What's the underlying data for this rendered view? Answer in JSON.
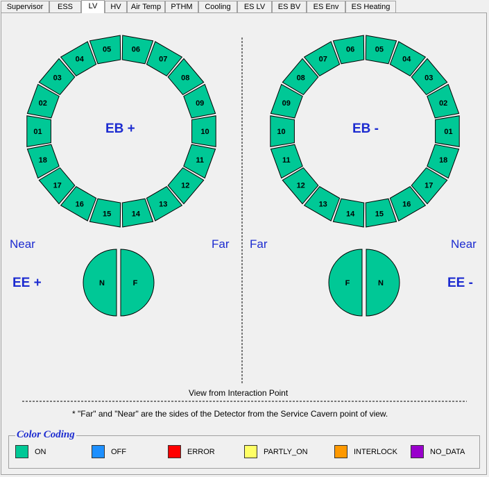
{
  "tabs": [
    {
      "label": "Supervisor",
      "active": false
    },
    {
      "label": "ESS",
      "active": false
    },
    {
      "label": "LV",
      "active": true
    },
    {
      "label": "HV",
      "active": false
    },
    {
      "label": "Air Temp",
      "active": false
    },
    {
      "label": "PTHM",
      "active": false
    },
    {
      "label": "Cooling",
      "active": false
    },
    {
      "label": "ES LV",
      "active": false
    },
    {
      "label": "ES BV",
      "active": false
    },
    {
      "label": "ES Env",
      "active": false
    },
    {
      "label": "ES Heating",
      "active": false
    }
  ],
  "colors": {
    "on": "#00c896",
    "off": "#1e90ff",
    "error": "#ff0000",
    "partly_on": "#ffff66",
    "interlock": "#ff9900",
    "no_data": "#9900cc",
    "accent_text": "#1c2bd0"
  },
  "eb_plus": {
    "label": "EB +",
    "sectors": [
      {
        "id": "01",
        "status": "on"
      },
      {
        "id": "02",
        "status": "on"
      },
      {
        "id": "03",
        "status": "on"
      },
      {
        "id": "04",
        "status": "on"
      },
      {
        "id": "05",
        "status": "on"
      },
      {
        "id": "06",
        "status": "on"
      },
      {
        "id": "07",
        "status": "on"
      },
      {
        "id": "08",
        "status": "on"
      },
      {
        "id": "09",
        "status": "on"
      },
      {
        "id": "10",
        "status": "on"
      },
      {
        "id": "11",
        "status": "on"
      },
      {
        "id": "12",
        "status": "on"
      },
      {
        "id": "13",
        "status": "on"
      },
      {
        "id": "14",
        "status": "on"
      },
      {
        "id": "15",
        "status": "on"
      },
      {
        "id": "16",
        "status": "on"
      },
      {
        "id": "17",
        "status": "on"
      },
      {
        "id": "18",
        "status": "on"
      }
    ]
  },
  "eb_minus": {
    "label": "EB -",
    "sectors": [
      {
        "id": "01",
        "status": "on"
      },
      {
        "id": "02",
        "status": "on"
      },
      {
        "id": "03",
        "status": "on"
      },
      {
        "id": "04",
        "status": "on"
      },
      {
        "id": "05",
        "status": "on"
      },
      {
        "id": "06",
        "status": "on"
      },
      {
        "id": "07",
        "status": "on"
      },
      {
        "id": "08",
        "status": "on"
      },
      {
        "id": "09",
        "status": "on"
      },
      {
        "id": "10",
        "status": "on"
      },
      {
        "id": "11",
        "status": "on"
      },
      {
        "id": "12",
        "status": "on"
      },
      {
        "id": "13",
        "status": "on"
      },
      {
        "id": "14",
        "status": "on"
      },
      {
        "id": "15",
        "status": "on"
      },
      {
        "id": "16",
        "status": "on"
      },
      {
        "id": "17",
        "status": "on"
      },
      {
        "id": "18",
        "status": "on"
      }
    ]
  },
  "ee_plus": {
    "label": "EE +",
    "left_side_label": "Near",
    "right_side_label": "Far",
    "halves": [
      {
        "id": "N",
        "status": "on"
      },
      {
        "id": "F",
        "status": "on"
      }
    ]
  },
  "ee_minus": {
    "label": "EE -",
    "left_side_label": "Far",
    "right_side_label": "Near",
    "halves": [
      {
        "id": "F",
        "status": "on"
      },
      {
        "id": "N",
        "status": "on"
      }
    ]
  },
  "view_caption": "View from Interaction Point",
  "footnote": "*  \"Far\" and \"Near\" are the sides of the Detector from the Service Cavern point of view.",
  "legend": {
    "title": "Color Coding",
    "items": [
      {
        "label": "ON",
        "color": "#00c896"
      },
      {
        "label": "OFF",
        "color": "#1e90ff"
      },
      {
        "label": "ERROR",
        "color": "#ff0000"
      },
      {
        "label": "PARTLY_ON",
        "color": "#ffff66"
      },
      {
        "label": "INTERLOCK",
        "color": "#ff9900"
      },
      {
        "label": "NO_DATA",
        "color": "#9900cc"
      }
    ]
  }
}
